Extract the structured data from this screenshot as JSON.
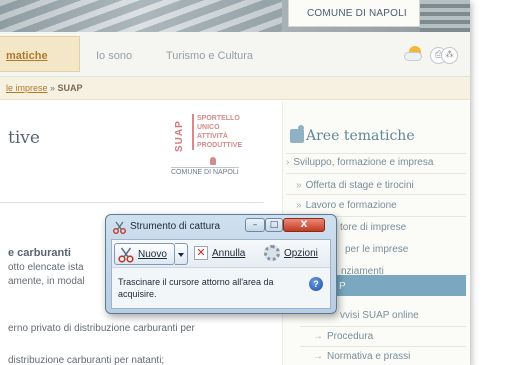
{
  "header": {
    "comune_label": "COMUNE DI NAPOLI"
  },
  "nav": {
    "items": [
      {
        "label": "matiche"
      },
      {
        "label": "Io sono"
      },
      {
        "label": "Turismo e Cultura"
      }
    ],
    "icons": [
      "weather-icon",
      "print-icon",
      "share-icon",
      "english-flag-icon"
    ]
  },
  "breadcrumb": {
    "link": "le imprese",
    "separator": " » ",
    "current": "SUAP"
  },
  "main": {
    "heading": "tive",
    "content_title": "e carburanti",
    "lines": [
      "otto elencate ista",
      "amente, in modal",
      "erno privato di distribuzione carburanti per",
      "distribuzione carburanti per natanti;"
    ]
  },
  "suap_logo": {
    "vertical": "SUAP",
    "lines": [
      "SPORTELLO",
      "UNICO",
      "ATTIVITÀ",
      "PRODUTTIVE"
    ],
    "comune": "COMUNE DI NAPOLI"
  },
  "sidebar": {
    "title": "Aree tematiche",
    "items": [
      {
        "label": "Sviluppo, formazione e impresa"
      },
      {
        "label": "Offerta di stage e tirocini"
      },
      {
        "label": "Lavoro e formazione"
      },
      {
        "label": "tore di imprese"
      },
      {
        "label": "per le imprese"
      },
      {
        "label": "nziamenti"
      },
      {
        "label": "P"
      },
      {
        "label": "vvisi SUAP online"
      },
      {
        "label": "Procedura"
      },
      {
        "label": "Normativa e prassi"
      }
    ],
    "highlight_color": "#7aa8c0"
  },
  "snipping_tool": {
    "title": "Strumento di cattura",
    "buttons": {
      "minimize": "–",
      "maximize": "□",
      "close": "X"
    },
    "toolbar": {
      "new_label": "Nuovo",
      "cancel_label": "Annulla",
      "options_label": "Opzioni"
    },
    "instructions": "Trascinare il cursore attorno all'area da acquisire.",
    "help": "?"
  },
  "colors": {
    "accent": "#b07a2d",
    "sidebar_title": "#5f8798",
    "close_button": "#c23b22"
  }
}
